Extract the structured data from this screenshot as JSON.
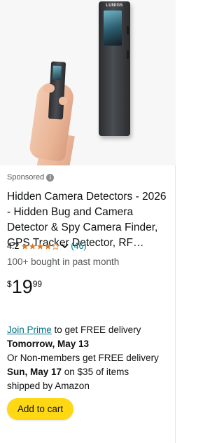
{
  "image": {
    "device_brand": "LUNIGS"
  },
  "sponsored": {
    "label": "Sponsored",
    "info_icon": "info-icon"
  },
  "product": {
    "title": "Hidden Camera Detectors - 2026 - Hidden Bug and Camera Detector & Spy Camera Finder, GPS Tracker Detector, RF…",
    "rating_value": "4.2",
    "rating_stars": 4.2,
    "review_count": "(46)",
    "bought": "100+ bought in past month",
    "price_symbol": "$",
    "price_whole": "19",
    "price_fraction": "99"
  },
  "delivery": {
    "prime_link": "Join Prime",
    "line1_rest": " to get FREE delivery",
    "date1": "Tomorrow, May 13",
    "line3": "Or Non-members get FREE delivery",
    "date2": "Sun, May 17",
    "line4_rest": " on $35 of items",
    "line5": "shipped by Amazon"
  },
  "actions": {
    "add_to_cart": "Add to cart"
  },
  "colors": {
    "star": "#de7921",
    "link": "#007185",
    "cart_button": "#ffd814"
  }
}
